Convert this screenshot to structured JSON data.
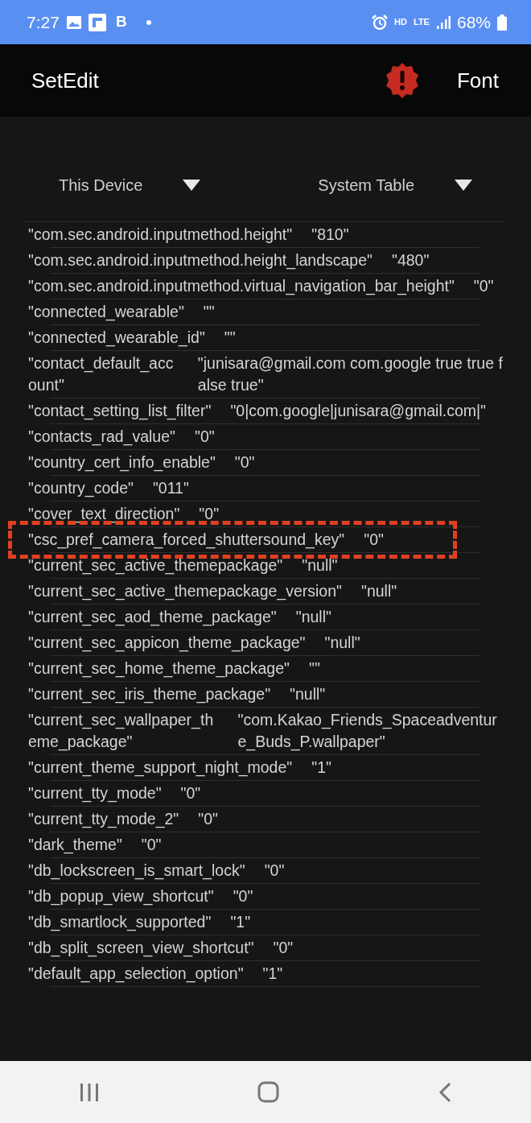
{
  "status_bar": {
    "time": "7:27",
    "notif_letter": "B",
    "hd": "HD",
    "lte": "LTE",
    "battery": "68%"
  },
  "app_bar": {
    "title": "SetEdit",
    "action": "Font"
  },
  "dropdowns": [
    {
      "label": "This Device"
    },
    {
      "label": "System Table"
    }
  ],
  "rows": [
    {
      "key": "\"com.sec.android.inputmethod.height\"",
      "value": "\"810\"",
      "highlighted": false
    },
    {
      "key": "\"com.sec.android.inputmethod.height_landscape\"",
      "value": "\"480\"",
      "highlighted": false
    },
    {
      "key": "\"com.sec.android.inputmethod.virtual_navigation_bar_height\"",
      "value": "\"0\"",
      "highlighted": false
    },
    {
      "key": "\"connected_wearable\"",
      "value": "\"\"",
      "highlighted": false
    },
    {
      "key": "\"connected_wearable_id\"",
      "value": "\"\"",
      "highlighted": false
    },
    {
      "key": "\"contact_default_account\"",
      "value": "\"junisara@gmail.com com.google  true true false true\"",
      "highlighted": false
    },
    {
      "key": "\"contact_setting_list_filter\"",
      "value": "\"0|com.google|junisara@gmail.com|\"",
      "highlighted": false
    },
    {
      "key": "\"contacts_rad_value\"",
      "value": "\"0\"",
      "highlighted": false
    },
    {
      "key": "\"country_cert_info_enable\"",
      "value": "\"0\"",
      "highlighted": false
    },
    {
      "key": "\"country_code\"",
      "value": "\"011\"",
      "highlighted": false
    },
    {
      "key": "\"cover_text_direction\"",
      "value": "\"0\"",
      "highlighted": false
    },
    {
      "key": "\"csc_pref_camera_forced_shuttersound_key\"",
      "value": "\"0\"",
      "highlighted": true
    },
    {
      "key": "\"current_sec_active_themepackage\"",
      "value": "\"null\"",
      "highlighted": false
    },
    {
      "key": "\"current_sec_active_themepackage_version\"",
      "value": "\"null\"",
      "highlighted": false
    },
    {
      "key": "\"current_sec_aod_theme_package\"",
      "value": "\"null\"",
      "highlighted": false
    },
    {
      "key": "\"current_sec_appicon_theme_package\"",
      "value": "\"null\"",
      "highlighted": false
    },
    {
      "key": "\"current_sec_home_theme_package\"",
      "value": "\"\"",
      "highlighted": false
    },
    {
      "key": "\"current_sec_iris_theme_package\"",
      "value": "\"null\"",
      "highlighted": false
    },
    {
      "key": "\"current_sec_wallpaper_theme_package\"",
      "value": "\"com.Kakao_Friends_Spaceadventure_Buds_P.wallpaper\"",
      "highlighted": false
    },
    {
      "key": "\"current_theme_support_night_mode\"",
      "value": "\"1\"",
      "highlighted": false
    },
    {
      "key": "\"current_tty_mode\"",
      "value": "\"0\"",
      "highlighted": false
    },
    {
      "key": "\"current_tty_mode_2\"",
      "value": "\"0\"",
      "highlighted": false
    },
    {
      "key": "\"dark_theme\"",
      "value": "\"0\"",
      "highlighted": false
    },
    {
      "key": "\"db_lockscreen_is_smart_lock\"",
      "value": "\"0\"",
      "highlighted": false
    },
    {
      "key": "\"db_popup_view_shortcut\"",
      "value": "\"0\"",
      "highlighted": false
    },
    {
      "key": "\"db_smartlock_supported\"",
      "value": "\"1\"",
      "highlighted": false
    },
    {
      "key": "\"db_split_screen_view_shortcut\"",
      "value": "\"0\"",
      "highlighted": false
    },
    {
      "key": "\"default_app_selection_option\"",
      "value": "\"1\"",
      "highlighted": false
    }
  ]
}
